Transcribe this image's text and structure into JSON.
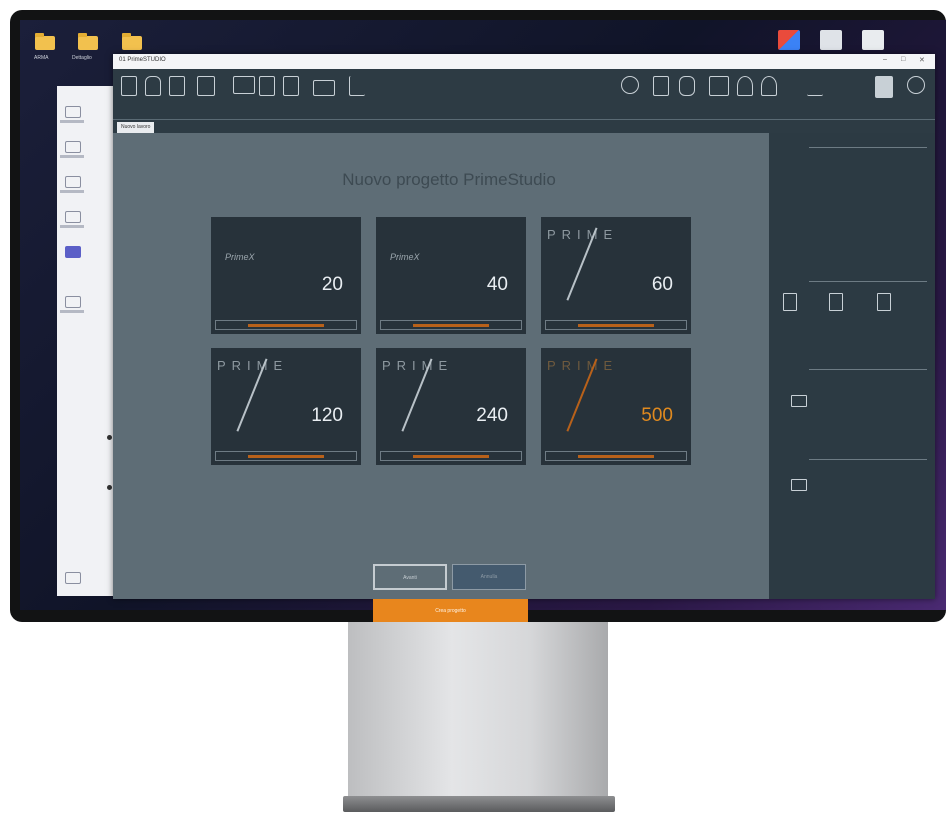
{
  "desktop": {
    "icons": [
      {
        "label": "ARMA"
      },
      {
        "label": "Dettaglio"
      },
      {
        "label": ""
      }
    ]
  },
  "window": {
    "title": "01 PrimeSTUDIO",
    "controls": {
      "minimize": "–",
      "maximize": "□",
      "close": "✕"
    }
  },
  "tab": {
    "label": "Nuovo lavoro"
  },
  "main": {
    "heading": "Nuovo progetto PrimeStudio",
    "cards": [
      {
        "value": "20",
        "style": "logo",
        "logo_text": "PrimeX"
      },
      {
        "value": "40",
        "style": "logo",
        "logo_text": "PrimeX"
      },
      {
        "value": "60",
        "style": "prime",
        "logo_text": "PRIME"
      },
      {
        "value": "120",
        "style": "prime",
        "logo_text": "PRIME"
      },
      {
        "value": "240",
        "style": "prime",
        "logo_text": "PRIME"
      },
      {
        "value": "500",
        "style": "prime",
        "logo_text": "PRIME",
        "accent": "#e08a1f"
      }
    ],
    "buttons": {
      "first": "Avanti",
      "second": "Annulla",
      "primary": "Crea progetto"
    }
  },
  "colors": {
    "accent": "#e8861d",
    "ribbon": "#2d3b44",
    "content_bg": "#5e6d76",
    "card_bg": "#27323a"
  }
}
